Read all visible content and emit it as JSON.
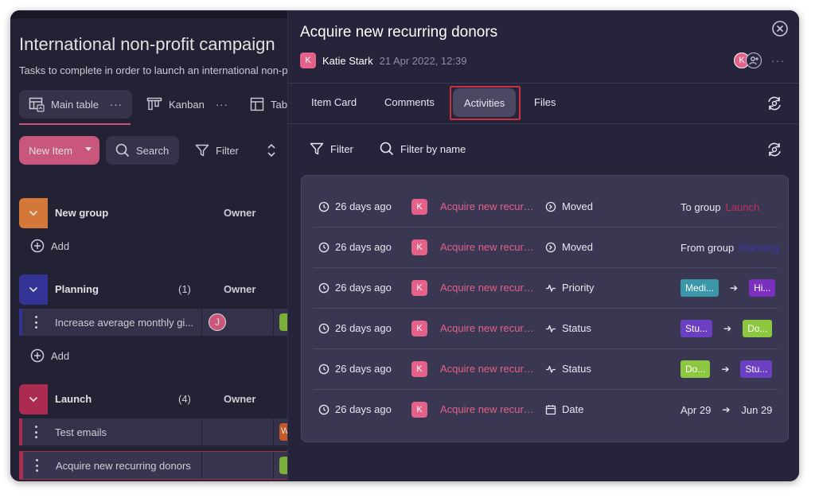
{
  "board": {
    "title": "International non-profit campaign",
    "subtitle": "Tasks to complete in order to launch an international non-pro",
    "views": [
      {
        "label": "Main table",
        "more": "···"
      },
      {
        "label": "Kanban",
        "more": "···"
      },
      {
        "label": "Tab"
      }
    ],
    "toolbar": {
      "new_item": "New Item",
      "search": "Search",
      "filter": "Filter"
    },
    "groups": [
      {
        "name": "New group",
        "count": "",
        "owner": "Owner",
        "color": "#f0883e",
        "add_label": "Add",
        "tasks": []
      },
      {
        "name": "Planning",
        "count": "(1)",
        "owner": "Owner",
        "color": "#3a39a8",
        "add_label": "Add",
        "tasks": [
          {
            "name": "Increase average monthly gi...",
            "avatar": "J",
            "status_color": "#8dc63f",
            "stripe": "#3a39a8"
          }
        ]
      },
      {
        "name": "Launch",
        "count": "(4)",
        "owner": "Owner",
        "color": "#c2305a",
        "tasks": [
          {
            "name": "Test emails",
            "avatar": "",
            "status_color": "#e0632b",
            "status_letter": "W",
            "stripe": "#c2305a"
          },
          {
            "name": "Acquire new recurring donors",
            "avatar": "",
            "status_color": "#8dc63f",
            "stripe": "#c2305a"
          }
        ]
      }
    ]
  },
  "panel": {
    "title": "Acquire new recurring donors",
    "author_initial": "K",
    "author_name": "Katie Stark",
    "date": "21 Apr 2022, 12:39",
    "member_initial": "K",
    "more": "···",
    "tabs": [
      {
        "label": "Item Card"
      },
      {
        "label": "Comments"
      },
      {
        "label": "Activities",
        "active": true
      },
      {
        "label": "Files"
      }
    ],
    "filter": "Filter",
    "filter_by_name": "Filter by name",
    "activities": [
      {
        "time": "26 days ago",
        "initial": "K",
        "item": "Acquire new recurri...",
        "type": "Moved",
        "icon": "moved-icon",
        "change": {
          "kind": "group",
          "prefix": "To group",
          "group": "Launch",
          "group_color": "#c2305a"
        }
      },
      {
        "time": "26 days ago",
        "initial": "K",
        "item": "Acquire new recurri...",
        "type": "Moved",
        "icon": "moved-icon",
        "change": {
          "kind": "group",
          "prefix": "From group",
          "group": "Planning",
          "group_color": "#3a39a8"
        }
      },
      {
        "time": "26 days ago",
        "initial": "K",
        "item": "Acquire new recurri...",
        "type": "Priority",
        "icon": "pulse-icon",
        "change": {
          "kind": "chips",
          "from": "Medi...",
          "from_color": "#3a97a8",
          "to": "Hi...",
          "to_color": "#7b2fbf"
        }
      },
      {
        "time": "26 days ago",
        "initial": "K",
        "item": "Acquire new recurri...",
        "type": "Status",
        "icon": "pulse-icon",
        "change": {
          "kind": "chips",
          "from": "Stu...",
          "from_color": "#6a3fc1",
          "to": "Do...",
          "to_color": "#8dc63f"
        }
      },
      {
        "time": "26 days ago",
        "initial": "K",
        "item": "Acquire new recurri...",
        "type": "Status",
        "icon": "pulse-icon",
        "change": {
          "kind": "chips",
          "from": "Do...",
          "from_color": "#8dc63f",
          "to": "Stu...",
          "to_color": "#6a3fc1"
        }
      },
      {
        "time": "26 days ago",
        "initial": "K",
        "item": "Acquire new recurri...",
        "type": "Date",
        "icon": "calendar-icon",
        "change": {
          "kind": "text",
          "from": "Apr 29",
          "to": "Jun 29"
        }
      }
    ]
  }
}
